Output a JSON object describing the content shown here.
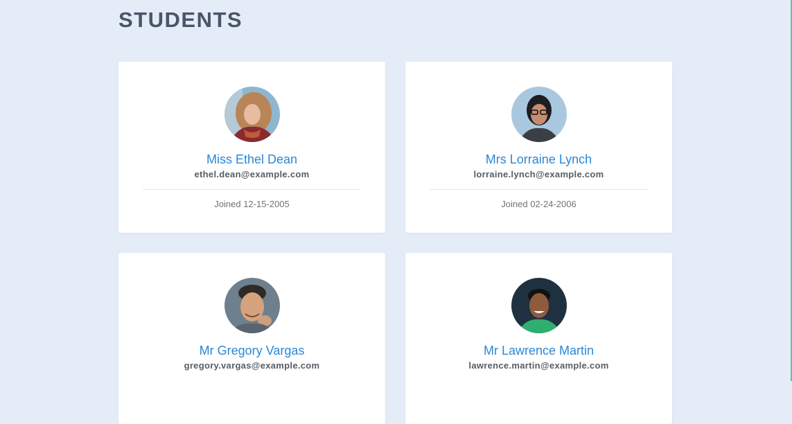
{
  "page": {
    "title": "STUDENTS"
  },
  "students": [
    {
      "name": "Miss Ethel Dean",
      "email": "ethel.dean@example.com",
      "joined": "Joined 12-15-2005",
      "avatar_colors": {
        "bg": "#8fb6cf",
        "hair": "#b88556",
        "skin": "#e7bca0",
        "clothes": "#8a2a2e"
      }
    },
    {
      "name": "Mrs Lorraine Lynch",
      "email": "lorraine.lynch@example.com",
      "joined": "Joined 02-24-2006",
      "avatar_colors": {
        "bg": "#a9c8df",
        "hair": "#1d1d22",
        "skin": "#c58e70",
        "clothes": "#3a3f46"
      }
    },
    {
      "name": "Mr Gregory Vargas",
      "email": "gregory.vargas@example.com",
      "joined": "",
      "avatar_colors": {
        "bg": "#6e7f8d",
        "hair": "#2f2a26",
        "skin": "#d7a27e",
        "clothes": "#5a6470"
      }
    },
    {
      "name": "Mr Lawrence Martin",
      "email": "lawrence.martin@example.com",
      "joined": "",
      "avatar_colors": {
        "bg": "#1f3140",
        "hair": "#111111",
        "skin": "#8f5a3e",
        "clothes": "#2fae70"
      }
    }
  ],
  "colors": {
    "background": "#e4ecf8",
    "card": "#ffffff",
    "name": "#2a87d6",
    "title": "#4b5568"
  }
}
